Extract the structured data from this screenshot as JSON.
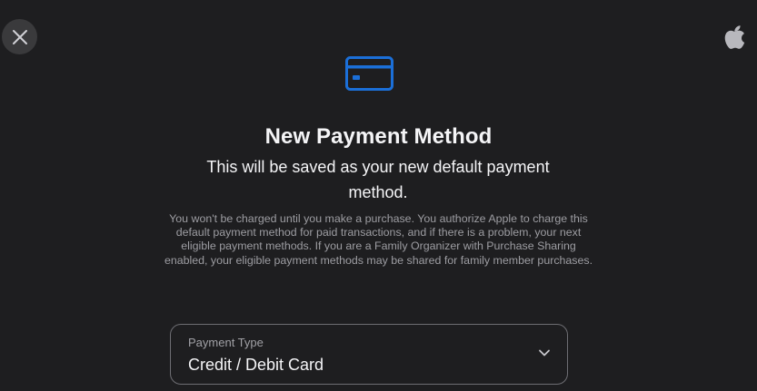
{
  "close_button": {
    "icon": "close-icon"
  },
  "brand": {
    "logo": "apple-logo"
  },
  "header": {
    "icon": "credit-card-icon",
    "title": "New Payment Method",
    "subtitle": "This will be saved as your new default payment method."
  },
  "disclaimer": "You won't be charged until you make a purchase. You authorize Apple to charge this default payment method for paid transactions, and if there is a problem, your next eligible payment methods. If you are a Family Organizer with Purchase Sharing enabled, your eligible payment methods may be shared for family member purchases.",
  "payment_type": {
    "label": "Payment Type",
    "value": "Credit / Debit Card",
    "icon": "chevron-down-icon"
  },
  "colors": {
    "background": "#1e1e20",
    "accent": "#1b6fd8",
    "text_primary": "#f5f5f7",
    "text_secondary": "#9d9da2"
  }
}
